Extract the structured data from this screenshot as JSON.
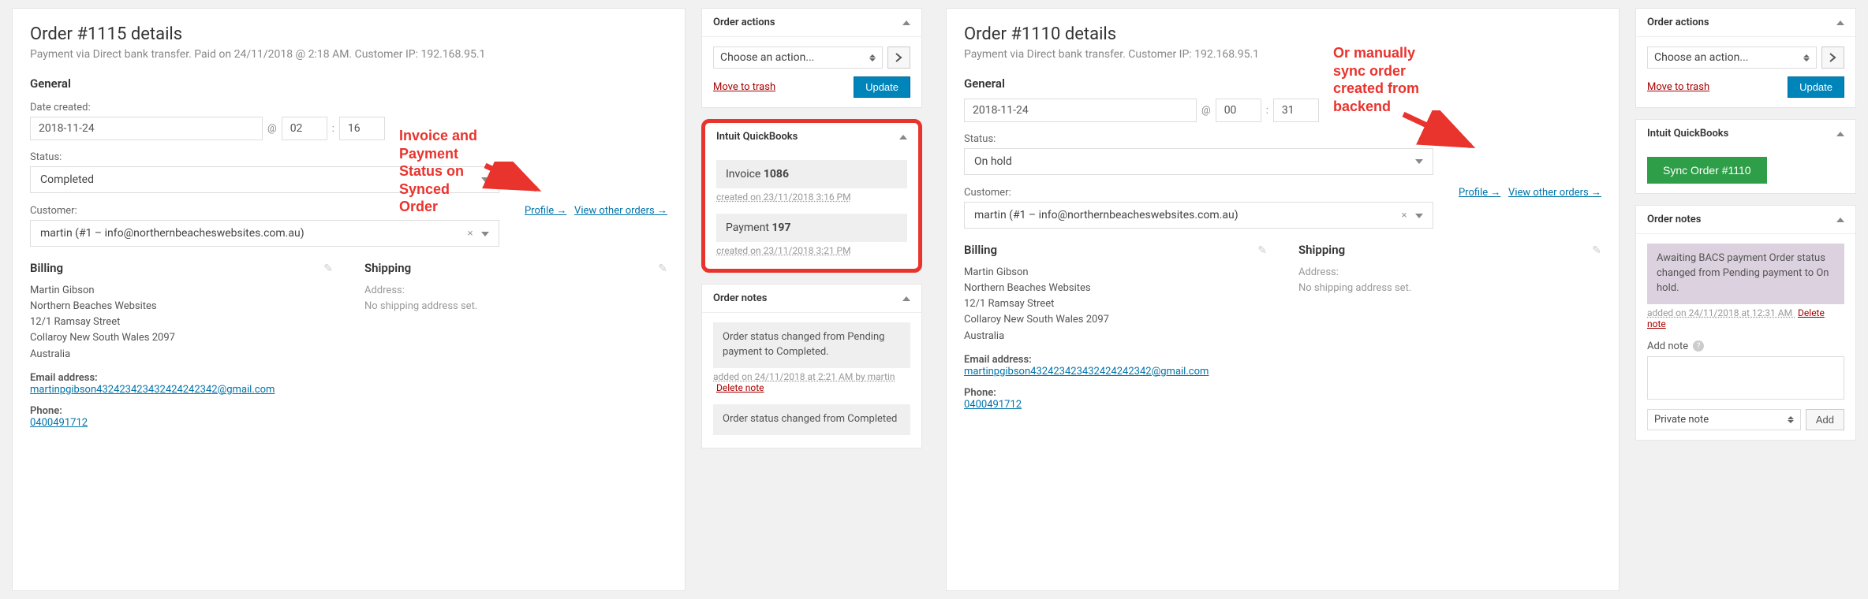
{
  "left": {
    "order_title": "Order #1115 details",
    "order_sub": "Payment via Direct bank transfer. Paid on 24/11/2018 @ 2:18 AM. Customer IP: 192.168.95.1",
    "general_heading": "General",
    "date_label": "Date created:",
    "date_value": "2018-11-24",
    "at_symbol": "@",
    "hour_value": "02",
    "colon": ":",
    "minute_value": "16",
    "status_label": "Status:",
    "status_value": "Completed",
    "customer_label": "Customer:",
    "profile_link": "Profile →",
    "view_orders_link": "View other orders →",
    "customer_value": "martin (#1 – info@northernbeacheswebsites.com.au)",
    "billing_heading": "Billing",
    "billing_lines": "Martin Gibson\nNorthern Beaches Websites\n12/1 Ramsay Street\nCollaroy New South Wales 2097\nAustralia",
    "email_label": "Email address:",
    "email_value": "martinpgibson432423423432424242342@gmail.com",
    "phone_label": "Phone:",
    "phone_value": "0400491712",
    "shipping_heading": "Shipping",
    "shipping_addr_label": "Address:",
    "shipping_none": "No shipping address set.",
    "sidebar": {
      "order_actions_title": "Order actions",
      "choose_action": "Choose an action...",
      "move_trash": "Move to trash",
      "update_btn": "Update",
      "qb_title": "Intuit QuickBooks",
      "invoice_label": "Invoice ",
      "invoice_num": "1086",
      "invoice_meta": "created on 23/11/2018 3:16 PM",
      "payment_label": "Payment ",
      "payment_num": "197",
      "payment_meta": "created on 23/11/2018 3:21 PM",
      "notes_title": "Order notes",
      "note1": "Order status changed from Pending payment to Completed.",
      "note1_meta": "added on 24/11/2018 at 2:21 AM",
      "note1_by": " by martin",
      "delete_note": "Delete note",
      "note2": "Order status changed from Completed"
    },
    "annot_text": "Invoice and\nPayment\nStatus on\nSynced\nOrder"
  },
  "right": {
    "order_title": "Order #1110 details",
    "order_sub": "Payment via Direct bank transfer. Customer IP: 192.168.95.1",
    "general_heading": "General",
    "date_value": "2018-11-24",
    "at_symbol": "@",
    "hour_value": "00",
    "colon": ":",
    "minute_value": "31",
    "status_label": "Status:",
    "status_value": "On hold",
    "customer_label": "Customer:",
    "profile_link": "Profile →",
    "view_orders_link": "View other orders →",
    "customer_value": "martin (#1 – info@northernbeacheswebsites.com.au)",
    "billing_heading": "Billing",
    "billing_lines": "Martin Gibson\nNorthern Beaches Websites\n12/1 Ramsay Street\nCollaroy New South Wales 2097\nAustralia",
    "email_label": "Email address:",
    "email_value": "martinpgibson432423423432424242342@gmail.com",
    "phone_label": "Phone:",
    "phone_value": "0400491712",
    "shipping_heading": "Shipping",
    "shipping_addr_label": "Address:",
    "shipping_none": "No shipping address set.",
    "sidebar": {
      "order_actions_title": "Order actions",
      "choose_action": "Choose an action...",
      "move_trash": "Move to trash",
      "update_btn": "Update",
      "qb_title": "Intuit QuickBooks",
      "sync_btn": "Sync Order #1110",
      "notes_title": "Order notes",
      "note1": "Awaiting BACS payment Order status changed from Pending payment to On hold.",
      "note1_meta": "added on 24/11/2018 at 12:31 AM",
      "delete_note": "Delete note",
      "add_note_label": "Add note",
      "note_type": "Private note",
      "add_btn": "Add"
    },
    "annot_text": "Or manually\nsync order\ncreated from\nbackend"
  }
}
